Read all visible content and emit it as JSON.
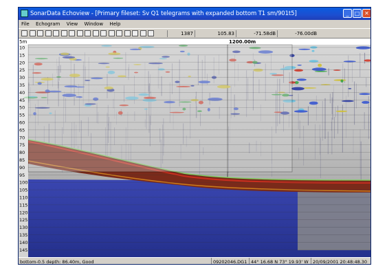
{
  "window": {
    "title": "SonarData Echoview - [Primary fileset: Sv Q1 telegrams with expanded bottom T1   sm/901t5]",
    "minimize": "_",
    "maximize": "□",
    "close": "✕"
  },
  "menu": [
    "File",
    "Echogram",
    "View",
    "Window",
    "Help"
  ],
  "toolbar": {
    "icons": [
      "new-icon",
      "open-icon",
      "save-icon",
      "print-icon",
      "select-icon",
      "line-pick-icon",
      "line-draw-icon",
      "spline-icon",
      "region-icon",
      "zoom-icon",
      "measure-icon",
      "marker-icon",
      "pan-icon",
      "layers-icon",
      "calibrate-icon",
      "settings-icon",
      "export-icon"
    ],
    "ping": "1387",
    "depth": "105.83",
    "sv1": "-71.58dB",
    "sv2": "-76.00dB"
  },
  "echogram": {
    "range_label": "5m",
    "distance_label": "1200.00m",
    "depth_ticks": [
      "10",
      "15",
      "20",
      "25",
      "30",
      "35",
      "40",
      "45",
      "50",
      "55",
      "60",
      "65",
      "70",
      "75",
      "80",
      "85",
      "90",
      "95",
      "100",
      "105",
      "110",
      "115",
      "120",
      "125",
      "130",
      "135",
      "140",
      "145"
    ],
    "colors": {
      "background_high": "#dcdcdc",
      "background_low": "#8a8a8a",
      "bottom_band": "#7a2a1a",
      "bottom_echo": "#e03020",
      "bottom_line": "#7fd060",
      "deep_blue": "#2a3aa8"
    }
  },
  "status": {
    "bottom": "bottom-0.5 depth: 86.40m, Good",
    "file": "09202046.DG1",
    "position": "44° 16.68 N 73° 19.93' W",
    "time": "20/09/2001 20:48:48.30"
  }
}
